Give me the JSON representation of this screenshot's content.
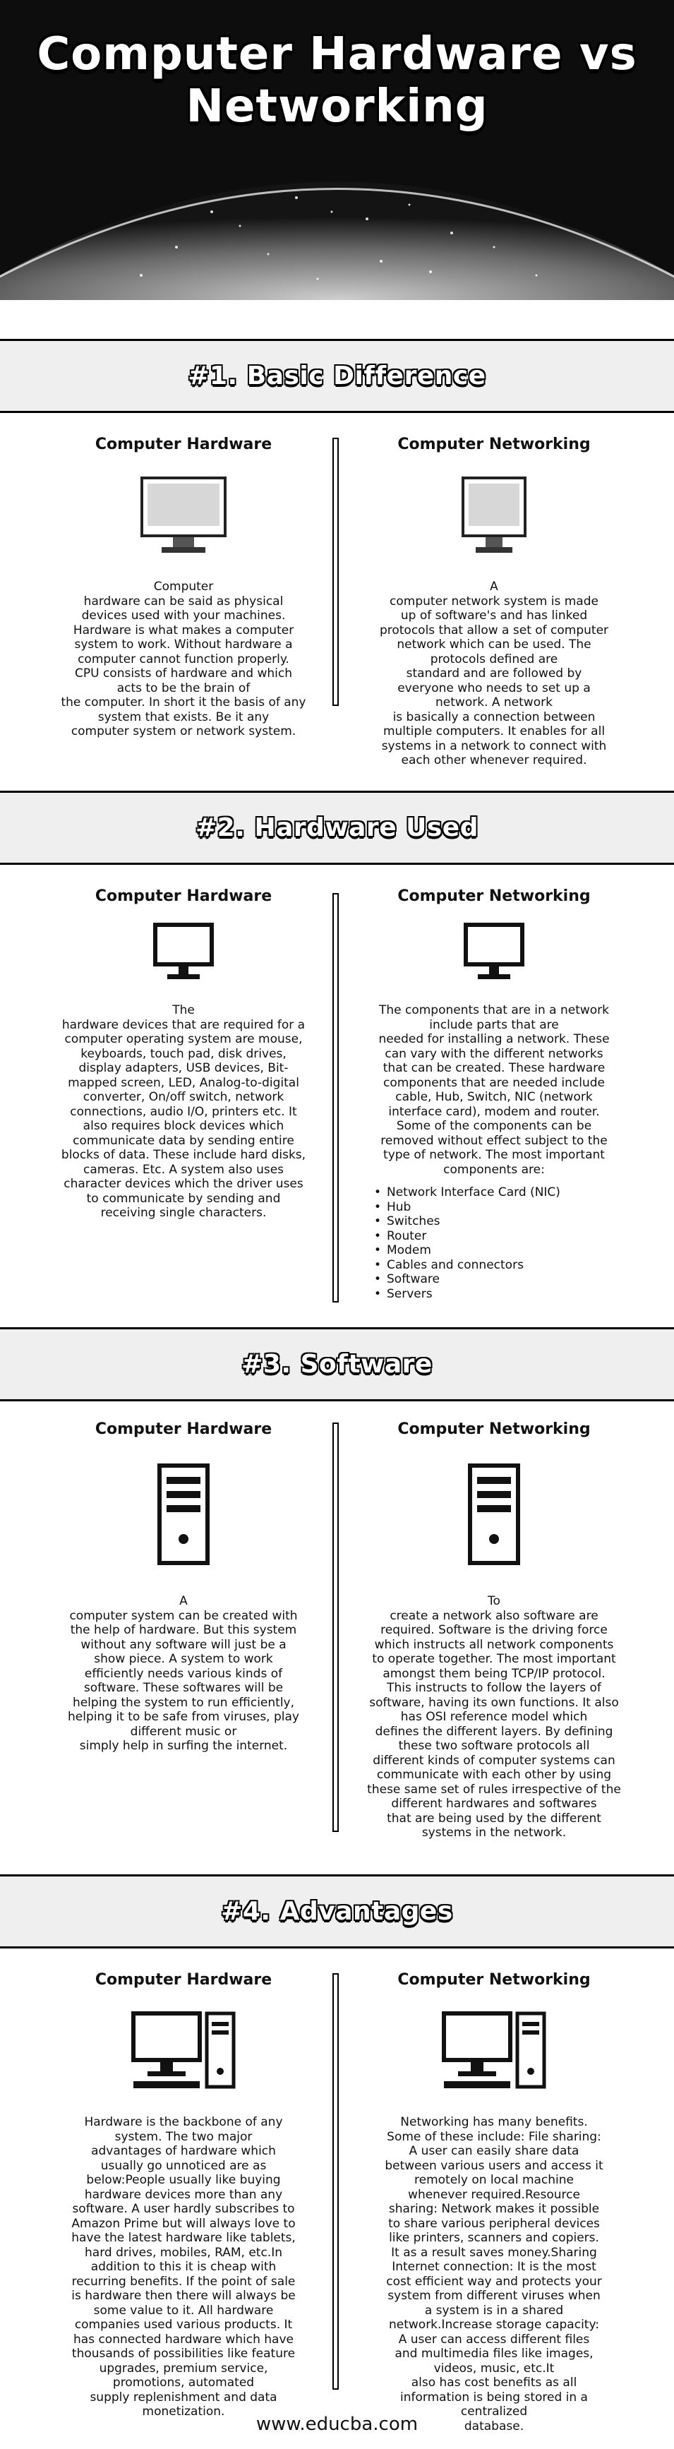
{
  "banner": {
    "title_line1": "Computer Hardware vs",
    "title_line2": "Networking"
  },
  "col_heads": {
    "left": "Computer Hardware",
    "right": "Computer Networking"
  },
  "sections": [
    {
      "heading": "#1. Basic Difference",
      "left_icon": "monitor-icon",
      "right_icon": "monitor-icon",
      "left_lines": [
        "Computer",
        "hardware can be said as physical",
        "devices used with your machines.",
        "Hardware is what makes a computer",
        "system to work. Without hardware a",
        "computer cannot function properly.",
        "CPU consists of hardware and which",
        "acts to be the brain of",
        "the computer. In short it the basis of any",
        "system that exists. Be it any",
        "computer system or network system."
      ],
      "right_lines": [
        "A",
        "computer network system is made",
        "up of software's and has linked",
        "protocols that allow a set of computer",
        "network which can be used. The",
        "protocols defined are",
        "standard and are followed by",
        "everyone who needs to set up a",
        "network. A network",
        "is basically a connection between",
        "multiple computers. It enables for all",
        "systems in a network to connect with",
        "each other whenever required."
      ]
    },
    {
      "heading": "#2. Hardware Used",
      "left_icon": "monitor-icon",
      "right_icon": "monitor-icon",
      "left_lines": [
        "The",
        "hardware devices that are required for a",
        "computer operating system are mouse,",
        "keyboards, touch pad, disk drives,",
        "display adapters, USB devices, Bit-",
        "mapped screen, LED, Analog-to-digital",
        "converter, On/off switch, network",
        "connections, audio I/O, printers etc. It",
        "also requires block devices which",
        "communicate data by sending entire",
        "blocks of data. These include hard disks,",
        "cameras. Etc. A system also uses",
        "character devices which the driver uses",
        "to communicate by sending and",
        "receiving single characters."
      ],
      "right_lines": [
        "The components that are in a network",
        "include parts that are",
        "needed for installing a network. These",
        "can vary with the different networks",
        "that can be created. These hardware",
        "components that are needed include",
        "cable, Hub, Switch, NIC (network",
        "interface card), modem and router.",
        "Some of the components can be",
        "removed without effect subject to the",
        "type of network. The most important",
        "components are:"
      ],
      "right_bullets": [
        "Network Interface Card (NIC)",
        "Hub",
        "Switches",
        "Router",
        "Modem",
        "Cables and connectors",
        "Software",
        "Servers"
      ]
    },
    {
      "heading": "#3. Software",
      "left_icon": "cpu-tower-icon",
      "right_icon": "cpu-tower-icon",
      "left_lines": [
        "A",
        "computer system can be created with",
        "the help of hardware. But this system",
        "without any software will just be a",
        "show piece. A system to work",
        "efficiently needs various kinds of",
        "software. These softwares will be",
        "helping the system to run efficiently,",
        "helping it to be safe from viruses, play",
        "different music or",
        "simply help in surfing the internet."
      ],
      "right_lines": [
        "To",
        "create a network also software are",
        "required. Software is the driving force",
        "which instructs all network components",
        "to operate together. The most important",
        "amongst them being TCP/IP protocol.",
        "This instructs to follow the layers of",
        "software, having its own functions. It also",
        "has OSI reference model which",
        "defines the different layers. By defining",
        "these two software protocols all",
        "different kinds of computer systems can",
        "communicate with each other by using",
        "these same set of rules irrespective of the",
        "different hardwares and softwares",
        "that are being used by the different",
        "systems in the network."
      ]
    },
    {
      "heading": "#4. Advantages",
      "left_icon": "desktop-computer-icon",
      "right_icon": "desktop-computer-icon",
      "left_lines": [
        "Hardware is the backbone of any",
        "system. The two major",
        "advantages of hardware which",
        "usually go unnoticed are as",
        "below:People usually like buying",
        "hardware devices more than any",
        "software. A user hardly subscribes to",
        "Amazon Prime but will always love to",
        "have the latest hardware like tablets,",
        "hard drives, mobiles, RAM, etc.In",
        "addition to this it is cheap with",
        "recurring benefits. If the point of sale",
        "is hardware then there will always be",
        "some value to it. All hardware",
        "companies used various products. It",
        "has connected hardware which have",
        "thousands of possibilities like feature",
        "upgrades, premium service,",
        "promotions, automated",
        "supply replenishment and data",
        "monetization."
      ],
      "right_lines": [
        "Networking has many benefits.",
        "Some of these include: File sharing:",
        "A user can easily share data",
        "between various users and access it",
        "remotely on local machine",
        "whenever required.Resource",
        "sharing: Network makes it possible",
        "to share various peripheral devices",
        "like printers, scanners and copiers.",
        "It as a result saves money.Sharing",
        "Internet connection: It is the most",
        "cost efficient way and protects your",
        "system from different viruses when",
        "a system is in a shared",
        "network.Increase storage capacity:",
        "A user can access different files",
        "and multimedia files like images,",
        "videos, music, etc.It",
        "also has cost benefits as all",
        "information is being stored in a",
        "centralized",
        "database."
      ]
    }
  ],
  "footer": {
    "url": "www.educba.com"
  }
}
